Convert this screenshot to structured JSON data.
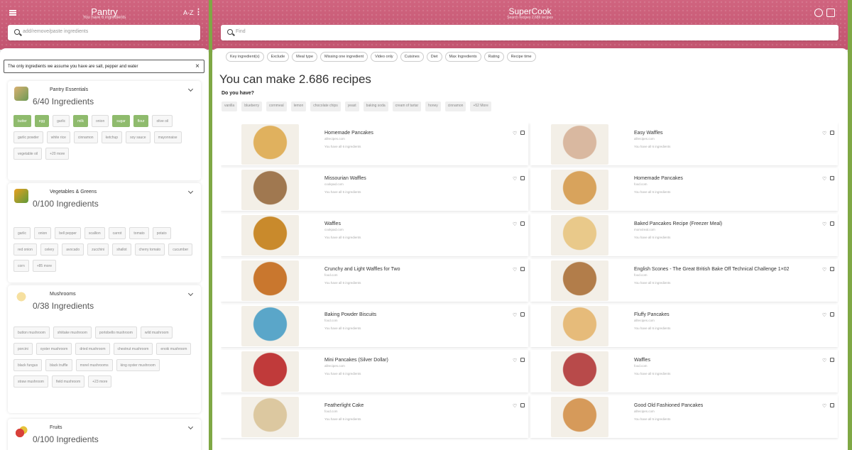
{
  "pantry": {
    "title": "Pantry",
    "subtitle": "You have 6 ingredients",
    "sort_label": "A-Z",
    "search_placeholder": "add/remove/paste ingredients",
    "notice": "The only ingredients we assume you have are salt, pepper and water",
    "categories": [
      {
        "name": "Pantry Essentials",
        "count": "6/40 Ingredients",
        "items": [
          {
            "label": "butter",
            "on": true
          },
          {
            "label": "egg",
            "on": true
          },
          {
            "label": "garlic",
            "on": false
          },
          {
            "label": "milk",
            "on": true
          },
          {
            "label": "onion",
            "on": false
          },
          {
            "label": "sugar",
            "on": true
          },
          {
            "label": "flour",
            "on": true
          },
          {
            "label": "olive oil",
            "on": false
          },
          {
            "label": "garlic powder",
            "on": false
          },
          {
            "label": "white rice",
            "on": false
          },
          {
            "label": "cinnamon",
            "on": false
          },
          {
            "label": "ketchup",
            "on": false
          },
          {
            "label": "soy sauce",
            "on": false
          },
          {
            "label": "mayonnaise",
            "on": false
          },
          {
            "label": "vegetable oil",
            "on": false
          },
          {
            "label": "+20 more",
            "on": false
          }
        ]
      },
      {
        "name": "Vegetables & Greens",
        "count": "0/100 Ingredients",
        "items": [
          {
            "label": "garlic"
          },
          {
            "label": "onion"
          },
          {
            "label": "bell pepper"
          },
          {
            "label": "scallion"
          },
          {
            "label": "carrot"
          },
          {
            "label": "tomato"
          },
          {
            "label": "potato"
          },
          {
            "label": "red onion"
          },
          {
            "label": "celery"
          },
          {
            "label": "avocado"
          },
          {
            "label": "zucchini"
          },
          {
            "label": "shallot"
          },
          {
            "label": "cherry tomato"
          },
          {
            "label": "cucumber"
          },
          {
            "label": "corn"
          },
          {
            "label": "+85 more"
          }
        ]
      },
      {
        "name": "Mushrooms",
        "count": "0/38 Ingredients",
        "items": [
          {
            "label": "button mushroom"
          },
          {
            "label": "shiitake mushroom"
          },
          {
            "label": "portobello mushroom"
          },
          {
            "label": "wild mushroom"
          },
          {
            "label": "porcini"
          },
          {
            "label": "oyster mushroom"
          },
          {
            "label": "dried mushroom"
          },
          {
            "label": "chestnut mushroom"
          },
          {
            "label": "enoki mushroom"
          },
          {
            "label": "black fungus"
          },
          {
            "label": "black truffle"
          },
          {
            "label": "morel mushrooms"
          },
          {
            "label": "king oyster mushroom"
          },
          {
            "label": "straw mushroom"
          },
          {
            "label": "field mushroom"
          },
          {
            "label": "+23 more"
          }
        ]
      },
      {
        "name": "Fruits",
        "count": "0/100 Ingredients",
        "items": []
      }
    ]
  },
  "main": {
    "title": "SuperCook",
    "subtitle": "Search recipes 2.686 recipes",
    "search_placeholder": "Find",
    "filters": [
      "Key ingredient(s)",
      "Exclude",
      "Meal type",
      "Missing one ingredient",
      "Video only",
      "Cuisines",
      "Diet",
      "Max Ingredients",
      "Rating",
      "Recipe time"
    ],
    "headline": "You can make 2.686 recipes",
    "do_you_have": "Do you have?",
    "suggestions": [
      "vanilla",
      "blueberry",
      "cornmeal",
      "lemon",
      "chocolate chips",
      "yeast",
      "baking soda",
      "cream of tartar",
      "honey",
      "cinnamon",
      "+52 More"
    ],
    "recipes": [
      {
        "title": "Homemade Pancakes",
        "source": "allrecipes.com",
        "have": "You have all 6 ingredients",
        "color": "#e0b15e"
      },
      {
        "title": "Easy Waffles",
        "source": "allrecipes.com",
        "have": "You have all 6 ingredients",
        "color": "#d9b8a0"
      },
      {
        "title": "Missourian Waffles",
        "source": "cookpad.com",
        "have": "You have all 5 ingredients",
        "color": "#a07850"
      },
      {
        "title": "Homemade Pancakes",
        "source": "food.com",
        "have": "You have all 6 ingredients",
        "color": "#d8a35c"
      },
      {
        "title": "Waffles",
        "source": "cookpad.com",
        "have": "You have all 6 ingredients",
        "color": "#c98a2c"
      },
      {
        "title": "Baked Pancakes Recipe (Freezer Meal)",
        "source": "mom4real.com",
        "have": "You have all 6 ingredients",
        "color": "#e9c98a"
      },
      {
        "title": "Crunchy and Light Waffles for Two",
        "source": "food.com",
        "have": "You have all 6 ingredients",
        "color": "#c9772e"
      },
      {
        "title": "English Scones - The Great British Bake Off Technical Challenge 1×02",
        "source": "food.com",
        "have": "You have all 6 ingredients",
        "color": "#b27d4a"
      },
      {
        "title": "Baking Powder Biscuits",
        "source": "food.com",
        "have": "You have all 6 ingredients",
        "color": "#5aa6c9"
      },
      {
        "title": "Fluffy Pancakes",
        "source": "allrecipes.com",
        "have": "You have all 6 ingredients",
        "color": "#e6bb7a"
      },
      {
        "title": "Mini Pancakes (Silver Dollar)",
        "source": "allrecipes.com",
        "have": "You have all 6 ingredients",
        "color": "#c03a3a"
      },
      {
        "title": "Waffles",
        "source": "food.com",
        "have": "You have all 6 ingredients",
        "color": "#b84a4a"
      },
      {
        "title": "Featherlight Cake",
        "source": "food.com",
        "have": "You have all 6 ingredients",
        "color": "#dcc8a0"
      },
      {
        "title": "Good Old Fashioned Pancakes",
        "source": "allrecipes.com",
        "have": "You have all 5 ingredients",
        "color": "#d69a5a"
      }
    ]
  },
  "colors": {
    "header": "#c95a78",
    "accent": "#7fa845",
    "chip_on": "#8fbb6d"
  }
}
